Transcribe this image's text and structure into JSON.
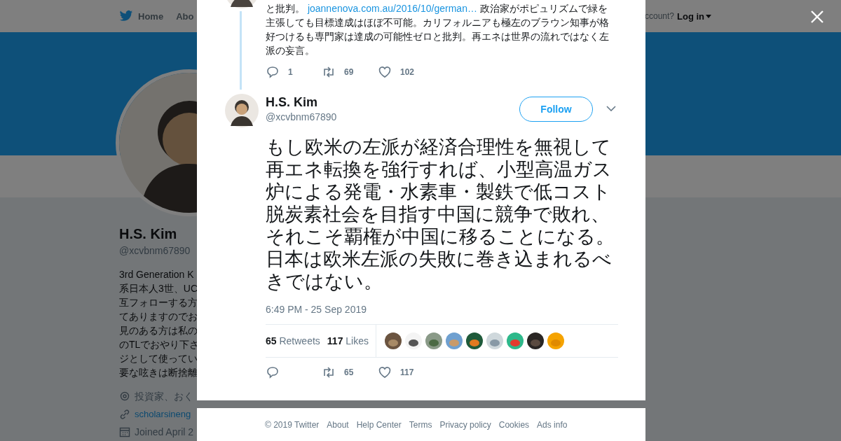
{
  "background_page": {
    "nav": {
      "items": [
        {
          "label": "Home",
          "kind": "home"
        },
        {
          "label": "Abo",
          "kind": "plain"
        }
      ],
      "account_prompt": "ccount?",
      "login": "Log in"
    },
    "profile": {
      "name": "H.S. Kim",
      "handle": "@xcvbnm67890",
      "bio_lines": [
        "3rd Generation K",
        "系日本人3世、UC",
        "互フォローする方",
        "てありますのでお",
        "見のある方は私の",
        "のTLでおやり下さ",
        "ジとして使ってい",
        "要な呟きは断捨離"
      ],
      "location": "投資家、おく",
      "link": "scholarsineng",
      "joined": "Joined April 2"
    }
  },
  "modal": {
    "previous_tweet": {
      "text_before": "と批判。",
      "link": "joannenova.com.au/2016/10/german…",
      "text_after": "政治家がポピュリズムで緑を主張しても目標達成はほぼ不可能。カリフォルニアも極左のブラウン知事が格好つけるも専門家は達成の可能性ゼロと批判。再エネは世界の流れではなく左派の妄言。",
      "actions": [
        {
          "kind": "reply",
          "count": "1"
        },
        {
          "kind": "retweet",
          "count": "69"
        },
        {
          "kind": "like",
          "count": "102"
        }
      ]
    },
    "tweet": {
      "name": "H.S. Kim",
      "handle": "@xcvbnm67890",
      "follow_button": "Follow",
      "text": "もし欧米の左派が経済合理性を無視して再エネ転換を強行すれば、小型高温ガス炉による発電・水素車・製鉄で低コスト脱炭素社会を目指す中国に競争で敗れ、それこそ覇権が中国に移ることになる。日本は欧米左派の失敗に巻き込まれるべきではない。",
      "time": "6:49 PM - 25 Sep 2019",
      "retweets_count": "65",
      "retweets_label": "Retweets",
      "likes_count": "117",
      "likes_label": "Likes",
      "actions": [
        {
          "kind": "reply"
        },
        {
          "kind": "retweet",
          "count": "65"
        },
        {
          "kind": "like",
          "count": "117"
        }
      ]
    },
    "footer_links": [
      "© 2019 Twitter",
      "About",
      "Help Center",
      "Terms",
      "Privacy policy",
      "Cookies",
      "Ads info"
    ]
  }
}
